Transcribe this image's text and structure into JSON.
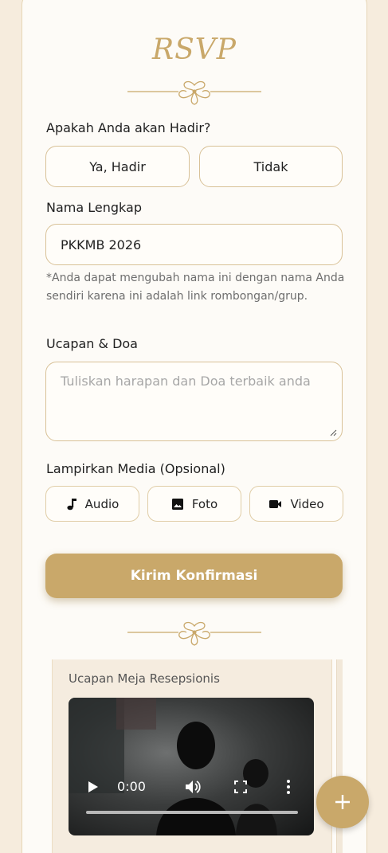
{
  "rsvp": {
    "title": "RSVP",
    "attendance_label": "Apakah Anda akan Hadir?",
    "option_yes": "Ya, Hadir",
    "option_no": "Tidak",
    "name_label": "Nama Lengkap",
    "name_value": "PKKMB 2026",
    "name_note": "*Anda dapat mengubah nama ini dengan nama Anda sendiri karena ini adalah link rombongan/grup.",
    "wish_label": "Ucapan & Doa",
    "wish_placeholder": "Tuliskan harapan dan Doa terbaik anda",
    "media_label": "Lampirkan Media (Opsional)",
    "media_buttons": [
      {
        "label": "Audio",
        "icon": "music-note-icon"
      },
      {
        "label": "Foto",
        "icon": "image-icon"
      },
      {
        "label": "Video",
        "icon": "videocam-icon"
      }
    ],
    "submit_label": "Kirim Konfirmasi"
  },
  "wishes": {
    "items": [
      {
        "name": "Ucapan Meja Resepsionis",
        "video_time": "0:00"
      }
    ]
  },
  "colors": {
    "accent": "#c9a86a",
    "background": "#f6ecdd",
    "card": "#fdfbf7",
    "border": "#d8c197"
  }
}
